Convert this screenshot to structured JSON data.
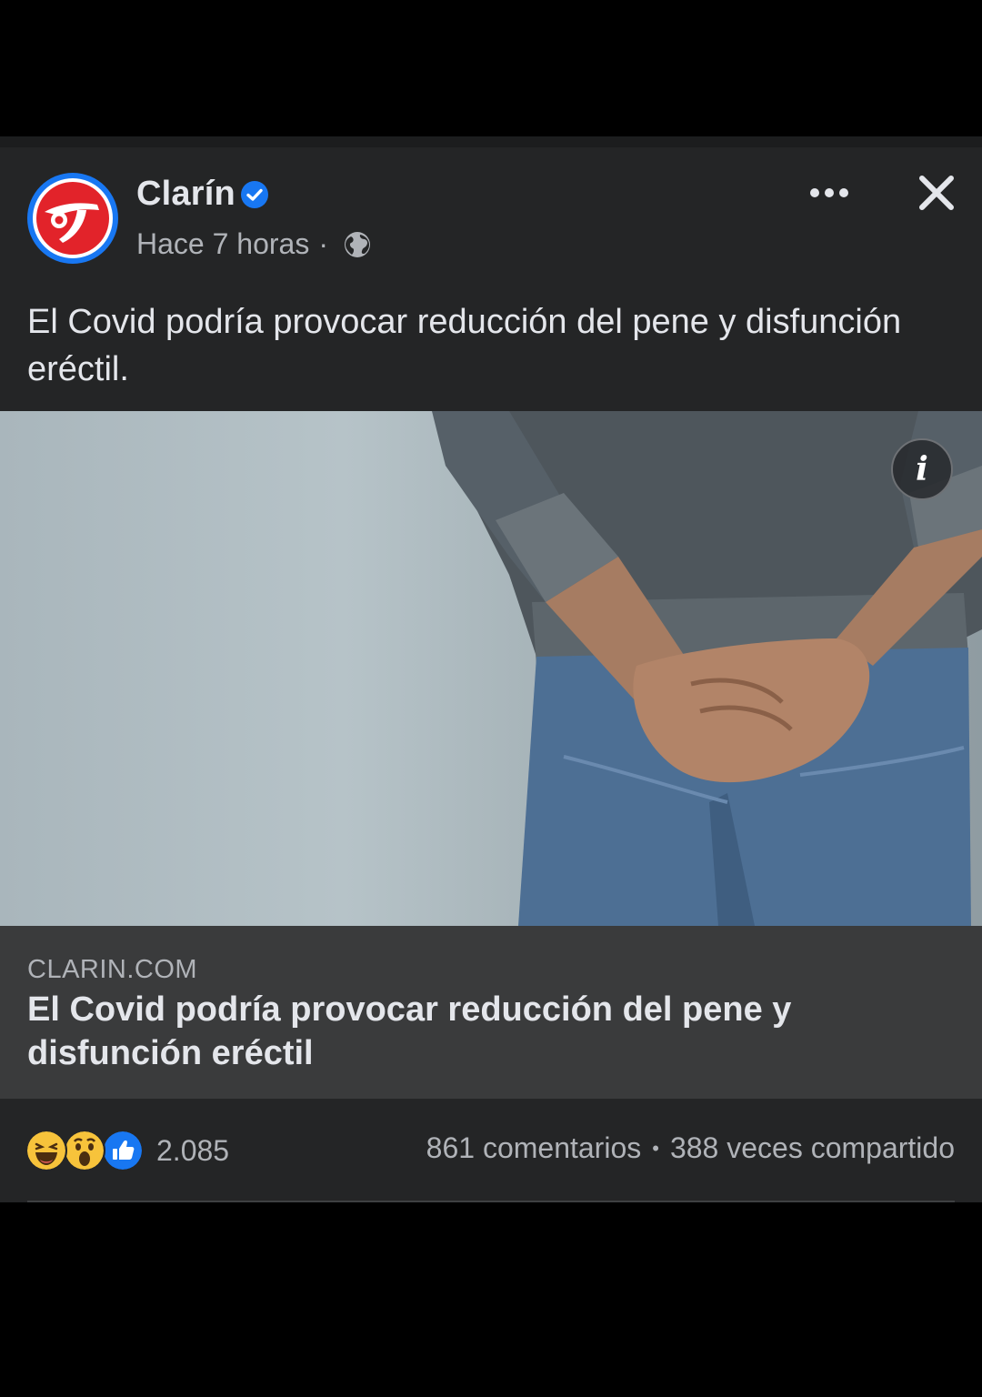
{
  "post": {
    "page_name": "Clarín",
    "time": "Hace 7 horas",
    "separator": "·",
    "privacy_icon": "globe-icon",
    "verified_icon": "verified-badge-icon",
    "more_icon": "more-options-icon",
    "close_icon": "close-icon",
    "text": "El Covid podría provocar reducción del pene y disfunción eréctil."
  },
  "media": {
    "info_label": "i"
  },
  "link_preview": {
    "domain": "CLARIN.COM",
    "title": "El Covid podría provocar reducción del pene y disfunción eréctil"
  },
  "stats": {
    "reactions": [
      "haha",
      "wow",
      "like"
    ],
    "reaction_count": "2.085",
    "comments": "861 comentarios",
    "dot": "•",
    "shares": "388 veces compartido"
  },
  "colors": {
    "background": "#000000",
    "card": "#242526",
    "link_box": "#3a3b3c",
    "primary_text": "#e4e6eb",
    "secondary_text": "#b0b3b8",
    "accent": "#1877f2",
    "brand_red": "#e2232a"
  }
}
